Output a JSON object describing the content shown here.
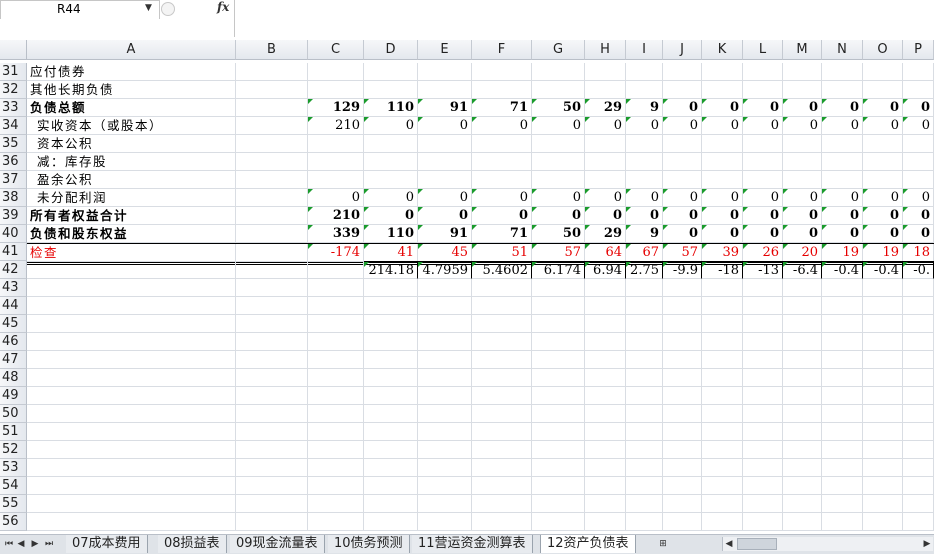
{
  "namebox": {
    "value": "R44"
  },
  "formula_bar": {
    "fx_label": "fx",
    "content": ""
  },
  "columns": [
    "A",
    "B",
    "C",
    "D",
    "E",
    "F",
    "G",
    "H",
    "I",
    "J",
    "K",
    "L",
    "M",
    "N",
    "O",
    "P"
  ],
  "rows": [
    {
      "n": "31",
      "label": "应付债券",
      "indent": false,
      "bold": false,
      "red": false,
      "tri": false,
      "values": []
    },
    {
      "n": "32",
      "label": "其他长期负债",
      "indent": false,
      "bold": false,
      "red": false,
      "tri": false,
      "values": []
    },
    {
      "n": "33",
      "label": "负债总额",
      "indent": false,
      "bold": true,
      "red": false,
      "tri": true,
      "values": [
        "129",
        "110",
        "91",
        "71",
        "50",
        "29",
        "9",
        "0",
        "0",
        "0",
        "0",
        "0",
        "0",
        "0"
      ]
    },
    {
      "n": "34",
      "label": "实收资本（或股本）",
      "indent": true,
      "bold": false,
      "red": false,
      "tri": true,
      "values": [
        "210",
        "0",
        "0",
        "0",
        "0",
        "0",
        "0",
        "0",
        "0",
        "0",
        "0",
        "0",
        "0",
        "0"
      ]
    },
    {
      "n": "35",
      "label": "资本公积",
      "indent": true,
      "bold": false,
      "red": false,
      "tri": false,
      "values": []
    },
    {
      "n": "36",
      "label": "减：库存股",
      "indent": true,
      "bold": false,
      "red": false,
      "tri": false,
      "values": []
    },
    {
      "n": "37",
      "label": "盈余公积",
      "indent": true,
      "bold": false,
      "red": false,
      "tri": false,
      "values": []
    },
    {
      "n": "38",
      "label": "未分配利润",
      "indent": true,
      "bold": false,
      "red": false,
      "tri": true,
      "values": [
        "0",
        "0",
        "0",
        "0",
        "0",
        "0",
        "0",
        "0",
        "0",
        "0",
        "0",
        "0",
        "0",
        "0"
      ]
    },
    {
      "n": "39",
      "label": "所有者权益合计",
      "indent": false,
      "bold": true,
      "red": false,
      "tri": true,
      "values": [
        "210",
        "0",
        "0",
        "0",
        "0",
        "0",
        "0",
        "0",
        "0",
        "0",
        "0",
        "0",
        "0",
        "0"
      ]
    },
    {
      "n": "40",
      "label": "负债和股东权益",
      "indent": false,
      "bold": true,
      "red": false,
      "tri": true,
      "values": [
        "339",
        "110",
        "91",
        "71",
        "50",
        "29",
        "9",
        "0",
        "0",
        "0",
        "0",
        "0",
        "0",
        "0"
      ]
    },
    {
      "n": "41",
      "label": "检查",
      "indent": false,
      "bold": false,
      "red": true,
      "tri": true,
      "values": [
        "-174",
        "41",
        "45",
        "51",
        "57",
        "64",
        "67",
        "57",
        "39",
        "26",
        "20",
        "19",
        "19",
        "18"
      ]
    },
    {
      "n": "42",
      "label": "",
      "indent": false,
      "bold": false,
      "red": false,
      "tri": true,
      "values": [
        "",
        "214.18",
        "4.7959",
        "5.4602",
        "6.174",
        "6.94",
        "2.75",
        "-9.9",
        "-18",
        "-13",
        "-6.4",
        "-0.4",
        "-0.4",
        "-0."
      ]
    },
    {
      "n": "43",
      "label": "",
      "values": []
    },
    {
      "n": "44",
      "label": "",
      "values": []
    },
    {
      "n": "45",
      "label": "",
      "values": []
    },
    {
      "n": "46",
      "label": "",
      "values": []
    },
    {
      "n": "47",
      "label": "",
      "values": []
    },
    {
      "n": "48",
      "label": "",
      "values": []
    },
    {
      "n": "49",
      "label": "",
      "values": []
    },
    {
      "n": "50",
      "label": "",
      "values": []
    },
    {
      "n": "51",
      "label": "",
      "values": []
    },
    {
      "n": "52",
      "label": "",
      "values": []
    },
    {
      "n": "53",
      "label": "",
      "values": []
    },
    {
      "n": "54",
      "label": "",
      "values": []
    },
    {
      "n": "55",
      "label": "",
      "values": []
    },
    {
      "n": "56",
      "label": "",
      "values": []
    }
  ],
  "sheet_tabs": [
    {
      "label": "07成本费用",
      "active": false
    },
    {
      "label": "08损益表",
      "active": false
    },
    {
      "label": "09现金流量表",
      "active": false
    },
    {
      "label": "10债务预测",
      "active": false
    },
    {
      "label": "11营运资金测算表",
      "active": false
    },
    {
      "label": "12资产负债表",
      "active": true
    }
  ],
  "colors": {
    "error_text": "#e60000",
    "indicator": "#1a9b2c",
    "header_bg": "#e4e8ee"
  }
}
